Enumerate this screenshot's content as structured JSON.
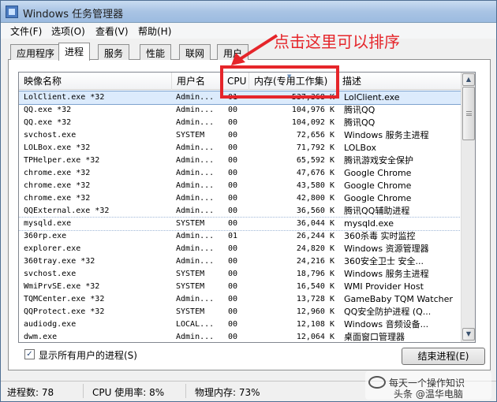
{
  "window": {
    "title": "Windows 任务管理器"
  },
  "menu": [
    "文件(F)",
    "选项(O)",
    "查看(V)",
    "帮助(H)"
  ],
  "tabs": [
    "应用程序",
    "进程",
    "服务",
    "性能",
    "联网",
    "用户"
  ],
  "active_tab": "进程",
  "columns": {
    "name": "映像名称",
    "user": "用户名",
    "cpu": "CPU",
    "memory": "内存(专用工作集)",
    "desc": "描述"
  },
  "processes": [
    {
      "name": "LolClient.exe *32",
      "user": "Admin...",
      "cpu": "01",
      "mem": "537,368 K",
      "desc": "LolClient.exe"
    },
    {
      "name": "QQ.exe *32",
      "user": "Admin...",
      "cpu": "00",
      "mem": "104,976 K",
      "desc": "腾讯QQ"
    },
    {
      "name": "QQ.exe *32",
      "user": "Admin...",
      "cpu": "00",
      "mem": "104,092 K",
      "desc": "腾讯QQ"
    },
    {
      "name": "svchost.exe",
      "user": "SYSTEM",
      "cpu": "00",
      "mem": "72,656 K",
      "desc": "Windows 服务主进程"
    },
    {
      "name": "LOLBox.exe *32",
      "user": "Admin...",
      "cpu": "00",
      "mem": "71,792 K",
      "desc": "LOLBox"
    },
    {
      "name": "TPHelper.exe *32",
      "user": "Admin...",
      "cpu": "00",
      "mem": "65,592 K",
      "desc": "腾讯游戏安全保护"
    },
    {
      "name": "chrome.exe *32",
      "user": "Admin...",
      "cpu": "00",
      "mem": "47,676 K",
      "desc": "Google Chrome"
    },
    {
      "name": "chrome.exe *32",
      "user": "Admin...",
      "cpu": "00",
      "mem": "43,580 K",
      "desc": "Google Chrome"
    },
    {
      "name": "chrome.exe *32",
      "user": "Admin...",
      "cpu": "00",
      "mem": "42,800 K",
      "desc": "Google Chrome"
    },
    {
      "name": "QQExternal.exe *32",
      "user": "Admin...",
      "cpu": "00",
      "mem": "36,560 K",
      "desc": "腾讯QQ辅助进程"
    },
    {
      "name": "mysqld.exe",
      "user": "SYSTEM",
      "cpu": "00",
      "mem": "36,044 K",
      "desc": "mysqld.exe"
    },
    {
      "name": "360rp.exe",
      "user": "Admin...",
      "cpu": "01",
      "mem": "26,244 K",
      "desc": "360杀毒 实时监控"
    },
    {
      "name": "explorer.exe",
      "user": "Admin...",
      "cpu": "00",
      "mem": "24,820 K",
      "desc": "Windows 资源管理器"
    },
    {
      "name": "360tray.exe *32",
      "user": "Admin...",
      "cpu": "00",
      "mem": "24,216 K",
      "desc": "360安全卫士 安全..."
    },
    {
      "name": "svchost.exe",
      "user": "SYSTEM",
      "cpu": "00",
      "mem": "18,796 K",
      "desc": "Windows 服务主进程"
    },
    {
      "name": "WmiPrvSE.exe *32",
      "user": "SYSTEM",
      "cpu": "00",
      "mem": "16,540 K",
      "desc": "WMI Provider Host"
    },
    {
      "name": "TQMCenter.exe *32",
      "user": "Admin...",
      "cpu": "00",
      "mem": "13,728 K",
      "desc": "GameBaby TQM Watcher"
    },
    {
      "name": "QQProtect.exe *32",
      "user": "SYSTEM",
      "cpu": "00",
      "mem": "12,960 K",
      "desc": "QQ安全防护进程 (Q..."
    },
    {
      "name": "audiodg.exe",
      "user": "LOCAL...",
      "cpu": "00",
      "mem": "12,108 K",
      "desc": "Windows 音频设备..."
    },
    {
      "name": "dwm.exe",
      "user": "Admin...",
      "cpu": "00",
      "mem": "12,064 K",
      "desc": "桌面窗口管理器"
    }
  ],
  "selected_process_index": 0,
  "focused_process_index": 10,
  "show_all_users": {
    "label": "显示所有用户的进程(S)",
    "checked": true
  },
  "end_process_button": "结束进程(E)",
  "status": {
    "processes": "进程数: 78",
    "cpu": "CPU 使用率: 8%",
    "memory": "物理内存: 73%"
  },
  "annotation": {
    "text": "点击这里可以排序",
    "color": "#e5252a"
  },
  "watermark": {
    "line1": "每天一个操作知识",
    "line2": "头条 @温华电脑"
  }
}
